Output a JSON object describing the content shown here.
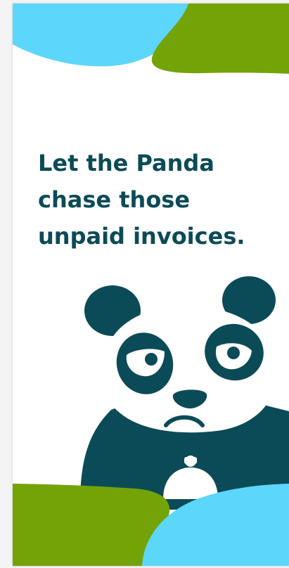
{
  "headline": {
    "line1": "Let the Panda",
    "line2": "chase those",
    "line3": "unpaid invoices."
  },
  "colors": {
    "teal_dark": "#0b4b57",
    "sky_blue": "#5dd6fb",
    "olive_green": "#73a306",
    "background": "#ffffff"
  },
  "illustration": {
    "subject": "frowning panda holding a call bell"
  }
}
